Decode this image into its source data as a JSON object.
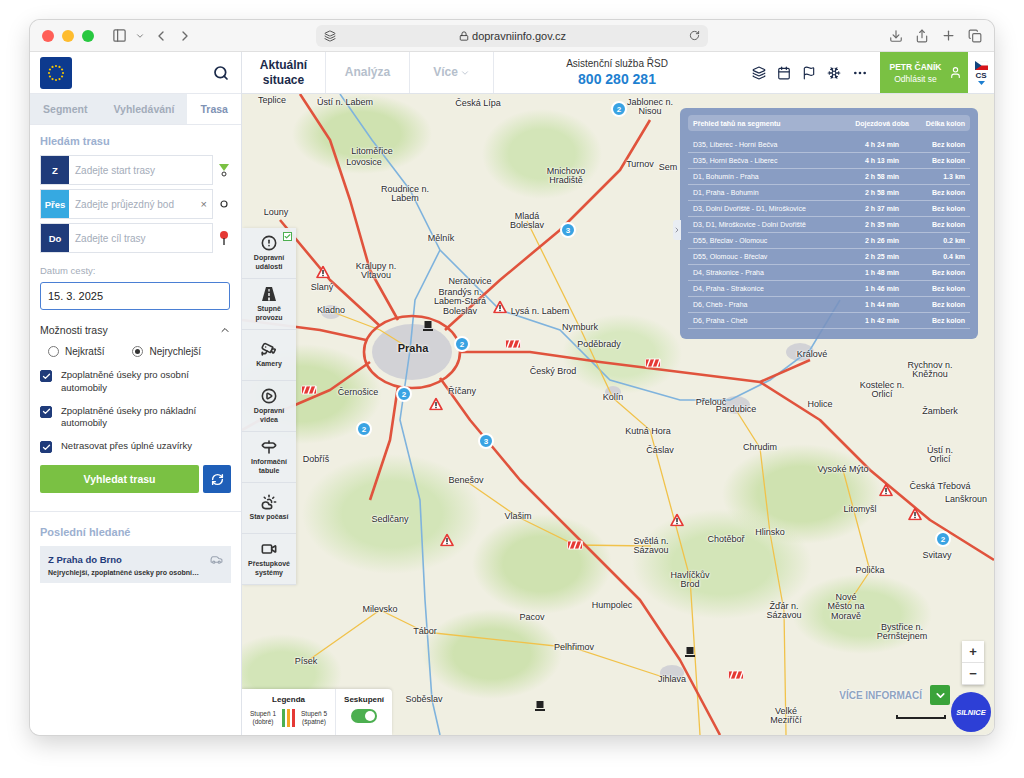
{
  "browser": {
    "url": "dopravniinfo.gov.cz"
  },
  "app": {
    "nav_tabs": [
      {
        "label": "Aktuální situace",
        "selected": true
      },
      {
        "label": "Analýza",
        "selected": false
      },
      {
        "label": "Více",
        "selected": false
      }
    ],
    "assist": {
      "label": "Asistenční služba ŘSD",
      "phone": "800 280 281"
    },
    "user": {
      "name": "PETR ČANÍK",
      "action": "Odhlásit se"
    },
    "language": "CS"
  },
  "sidebar": {
    "tabs": [
      {
        "label": "Segment",
        "selected": false
      },
      {
        "label": "Vyhledávání",
        "selected": false
      },
      {
        "label": "Trasa",
        "selected": true
      }
    ],
    "route": {
      "title": "Hledám trasu",
      "fields": [
        {
          "kind": "start",
          "badge": "Z",
          "placeholder": "Zadejte start trasy",
          "color": "#1f3b7a"
        },
        {
          "kind": "via",
          "badge": "Přes",
          "placeholder": "Zadejte průjezdný bod",
          "clear": "×",
          "color": "#36a9e1"
        },
        {
          "kind": "end",
          "badge": "Do",
          "placeholder": "Zadejte cíl trasy",
          "color": "#1f3b7a"
        }
      ],
      "date_label": "Datum cesty:",
      "date": "15. 3. 2025",
      "options_title": "Možnosti trasy",
      "options_expanded": true,
      "radios": [
        {
          "label": "Nejkratší",
          "selected": false
        },
        {
          "label": "Nejrychlejší",
          "selected": true
        }
      ],
      "checkboxes": [
        {
          "label": "Zpoplatněné úseky pro osobní automobily",
          "checked": true
        },
        {
          "label": "Zpoplatněné úseky pro nákladní automobily",
          "checked": true
        },
        {
          "label": "Netrasovat přes úplné uzavírky",
          "checked": true
        }
      ],
      "search_button": "Vyhledat trasu"
    },
    "recent": {
      "title": "Poslední hledané",
      "items": [
        {
          "title": "Z Praha do Brno",
          "detail": "Nejrychlejší, zpoplatněné úseky pro osobní…"
        }
      ]
    }
  },
  "layers": [
    {
      "label": "Dopravní události",
      "checked": true
    },
    {
      "label": "Stupně provozu",
      "checked": false
    },
    {
      "label": "Kamery",
      "checked": false
    },
    {
      "label": "Dopravní videa",
      "checked": false
    },
    {
      "label": "Informační tabule",
      "checked": false
    },
    {
      "label": "Stav počasí",
      "checked": false
    },
    {
      "label": "Přestupkové systémy",
      "checked": false
    }
  ],
  "segment_table": {
    "columns": [
      "Přehled tahů na segmentu",
      "Dojezdová doba",
      "Délka kolon"
    ],
    "rows": [
      [
        "D35, Liberec - Horní Bečva",
        "4 h 24 min",
        "Bez kolon"
      ],
      [
        "D35, Horní Bečva - Liberec",
        "4 h 13 min",
        "Bez kolon"
      ],
      [
        "D1, Bohumín - Praha",
        "2 h 58 min",
        "1.3 km"
      ],
      [
        "D1, Praha - Bohumín",
        "2 h 58 min",
        "Bez kolon"
      ],
      [
        "D3, Dolní Dvořiště - D1, Miroškovice",
        "2 h 37 min",
        "Bez kolon"
      ],
      [
        "D3, D1, Miroškovice - Dolní Dvořiště",
        "2 h 35 min",
        "Bez kolon"
      ],
      [
        "D55, Břeclav - Olomouc",
        "2 h 26 min",
        "0.2 km"
      ],
      [
        "D55, Olomouc - Břeclav",
        "2 h 25 min",
        "0.4 km"
      ],
      [
        "D4, Strakonice - Praha",
        "1 h 48 min",
        "Bez kolon"
      ],
      [
        "D4, Praha - Strakonice",
        "1 h 46 min",
        "Bez kolon"
      ],
      [
        "D6, Cheb - Praha",
        "1 h 44 min",
        "Bez kolon"
      ],
      [
        "D6, Praha - Cheb",
        "1 h 42 min",
        "Bez kolon"
      ]
    ]
  },
  "map": {
    "capital": "Praha",
    "places": [
      "Teplice",
      "Ústí n. Labem",
      "Česká Lípa",
      "Jablonec n. Nisou",
      "Litoměřice",
      "Lovosice",
      "Turnov",
      "Mnichovo Hradiště",
      "Roudnice n. Labem",
      "Louny",
      "Mladá Boleslav",
      "Mělník",
      "Kralupy n. Vltavou",
      "Neratovice",
      "Brandýs n. Labem-Stará Boleslav",
      "Slaný",
      "Kladno",
      "Lysá n. Labem",
      "Nymburk",
      "Poděbrady",
      "Králové",
      "Rychnov n. Kněžnou",
      "Černošice",
      "Říčany",
      "Český Brod",
      "Kolín",
      "Přelouč",
      "Pardubice",
      "Holice",
      "Kostelec n. Orlicí",
      "Žamberk",
      "Kutná Hora",
      "Čáslav",
      "Chrudim",
      "Dobříš",
      "Benešov",
      "Vysoké Mýto",
      "Ústí n. Orlicí",
      "Česká Třebová",
      "Lanškroun",
      "Litomyšl",
      "Svitavy",
      "Vlašim",
      "Sedlčany",
      "Světlá n. Sázavou",
      "Chotěboř",
      "Hlinsko",
      "Polička",
      "Havlíčkův Brod",
      "Žďár n. Sázavou",
      "Nové Město na Moravě",
      "Bystřice n. Pernštejnem",
      "Humpolec",
      "Pacov",
      "Milevsko",
      "Tábor",
      "Pelhřimov",
      "Písek",
      "Jihlava",
      "Soběslav",
      "Velké Meziříčí",
      "Sem"
    ],
    "clusters": [
      "2",
      "3",
      "2",
      "2",
      "2",
      "3",
      "2"
    ],
    "incidents": [
      {
        "kind": "warning"
      },
      {
        "kind": "warning"
      },
      {
        "kind": "warning"
      },
      {
        "kind": "warning"
      },
      {
        "kind": "warning"
      },
      {
        "kind": "warning"
      },
      {
        "kind": "warning"
      },
      {
        "kind": "closure"
      },
      {
        "kind": "closure"
      },
      {
        "kind": "closure"
      },
      {
        "kind": "closure"
      },
      {
        "kind": "closure"
      },
      {
        "kind": "work"
      },
      {
        "kind": "work"
      },
      {
        "kind": "work"
      }
    ]
  },
  "legend": {
    "title": "Legenda",
    "low": "Stupeň 1",
    "low_note": "(dobré)",
    "high": "Stupeň 5",
    "high_note": "(špatné)",
    "scale": [
      {
        "color": "#4caf50"
      },
      {
        "color": "#f5a623"
      },
      {
        "color": "#e53935"
      }
    ]
  },
  "grouping": {
    "label": "Seskupení",
    "on": true
  },
  "more_info": "VÍCE INFORMACÍ",
  "zoom": [
    "+",
    "−"
  ],
  "badge": "SILNICE"
}
